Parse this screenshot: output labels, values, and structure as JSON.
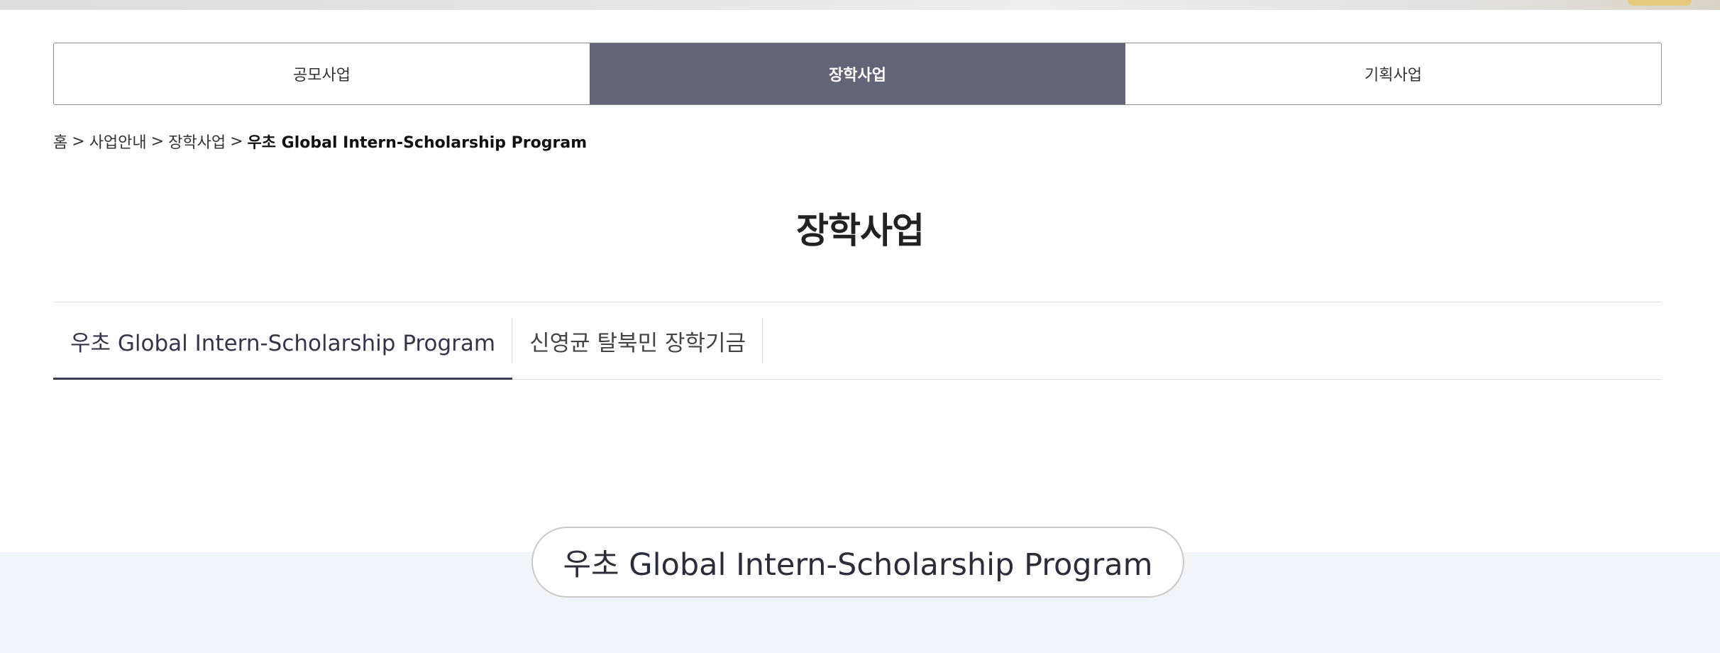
{
  "top_tabs": [
    {
      "label": "공모사업",
      "active": false
    },
    {
      "label": "장학사업",
      "active": true
    },
    {
      "label": "기획사업",
      "active": false
    }
  ],
  "breadcrumb": {
    "items": [
      "홈",
      "사업안내",
      "장학사업"
    ],
    "separator": ">",
    "current": "우초 Global Intern-Scholarship Program"
  },
  "page_title": "장학사업",
  "sub_tabs": [
    {
      "label": "우초 Global Intern-Scholarship Program",
      "active": true
    },
    {
      "label": "신영균 탈북민 장학기금",
      "active": false
    }
  ],
  "section": {
    "heading": "우초 Global Intern-Scholarship Program"
  },
  "colors": {
    "active_tab_bg": "#646478",
    "section_bg": "#f1f4f8",
    "active_underline": "#3b3b4f"
  }
}
